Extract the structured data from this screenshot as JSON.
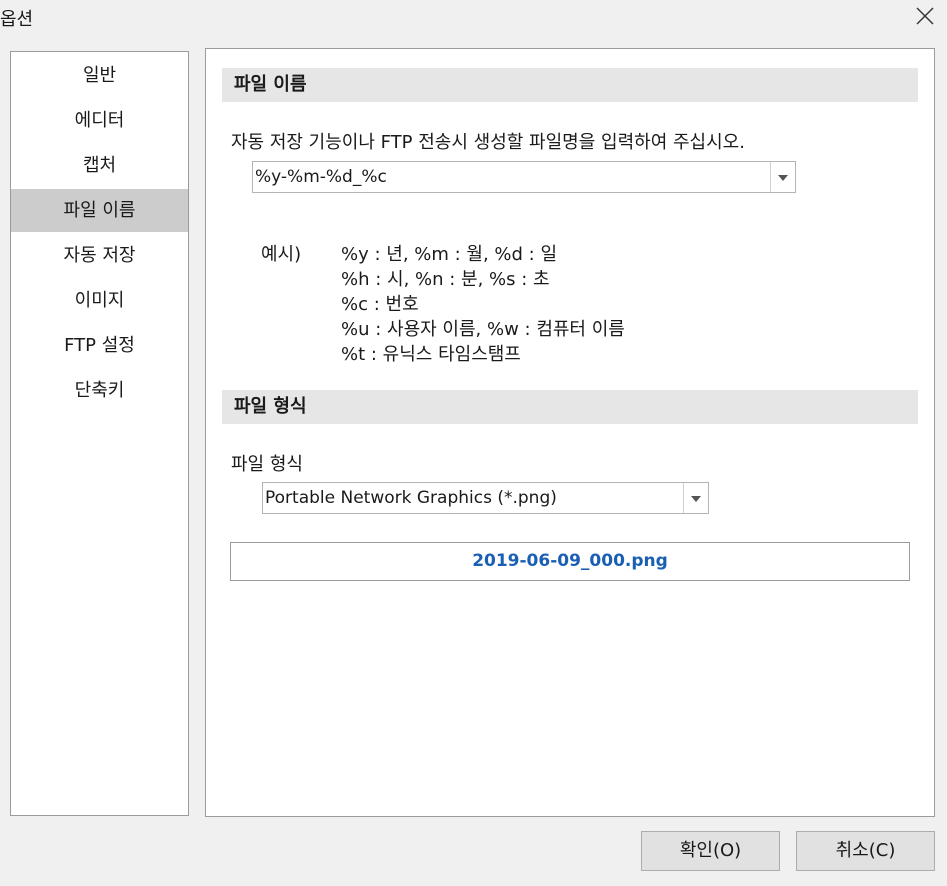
{
  "window": {
    "title": "옵션"
  },
  "sidebar": {
    "items": [
      {
        "label": "일반"
      },
      {
        "label": "에디터"
      },
      {
        "label": "캡처"
      },
      {
        "label": "파일 이름",
        "selected": true
      },
      {
        "label": "자동 저장"
      },
      {
        "label": "이미지"
      },
      {
        "label": "FTP 설정"
      },
      {
        "label": "단축키"
      }
    ]
  },
  "filename_section": {
    "header": "파일 이름",
    "description": "자동 저장 기능이나 FTP 전송시 생성할 파일명을 입력하여 주십시오.",
    "pattern_value": "%y-%m-%d_%c",
    "example_label": "예시)",
    "example_lines": [
      "%y : 년, %m : 월, %d : 일",
      "%h : 시, %n : 분, %s : 초",
      "%c : 번호",
      "%u : 사용자 이름, %w : 컴퓨터 이름",
      "%t : 유닉스 타임스탬프"
    ]
  },
  "format_section": {
    "header": "파일 형식",
    "label": "파일 형식",
    "selected_format": "Portable Network Graphics (*.png)",
    "preview_filename": "2019-06-09_000.png"
  },
  "buttons": {
    "ok": "확인(O)",
    "cancel": "취소(C)"
  },
  "colors": {
    "selected_item_bg": "#cccccc",
    "section_header_bg": "#e6e6e6",
    "preview_text": "#1a5fb4"
  }
}
